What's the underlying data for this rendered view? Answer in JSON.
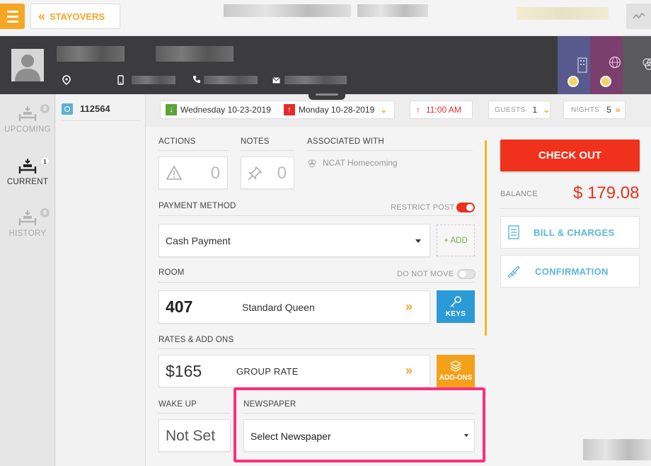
{
  "topbar": {
    "back_label": "STAYOVERS"
  },
  "nav": {
    "items": [
      {
        "label": "UPCOMING",
        "badge": "0"
      },
      {
        "label": "CURRENT",
        "badge": "1"
      },
      {
        "label": "HISTORY",
        "badge": "0"
      }
    ]
  },
  "reservation": {
    "number": "112564"
  },
  "stay": {
    "arrival": "Wednesday 10-23-2019",
    "departure": "Monday 10-28-2019",
    "time": "11:00 AM",
    "guests_label": "GUESTS",
    "guests": "1",
    "nights_label": "NIGHTS",
    "nights": "5"
  },
  "actions": {
    "label": "ACTIONS",
    "count": "0"
  },
  "notes": {
    "label": "NOTES",
    "count": "0"
  },
  "associated": {
    "label": "ASSOCIATED WITH",
    "value": "NCAT Homecoming"
  },
  "payment": {
    "label": "PAYMENT METHOD",
    "restrict_label": "RESTRICT POST",
    "restrict_on": true,
    "selected": "Cash Payment",
    "add_label": "+ ADD"
  },
  "room": {
    "label": "ROOM",
    "do_not_move_label": "DO NOT MOVE",
    "number": "407",
    "type": "Standard Queen",
    "keys_label": "KEYS"
  },
  "rates": {
    "label": "RATES & ADD ONS",
    "amount": "$165",
    "rate_name": "GROUP RATE",
    "addons_label": "ADD-ONS"
  },
  "wakeup": {
    "label": "WAKE UP",
    "value": "Not Set"
  },
  "newspaper": {
    "label": "NEWSPAPER",
    "selected": "Select Newspaper"
  },
  "sidebar": {
    "checkout_label": "CHECK OUT",
    "balance_label": "BALANCE",
    "balance": "$ 179.08",
    "bill_label": "BILL & CHARGES",
    "confirmation_label": "CONFIRMATION"
  },
  "colors": {
    "accent": "#f5a623",
    "checkout": "#f0311b",
    "link_blue": "#5bb7d9",
    "highlight": "#ff2d7a",
    "guest_bar": "#3c3c3e"
  }
}
